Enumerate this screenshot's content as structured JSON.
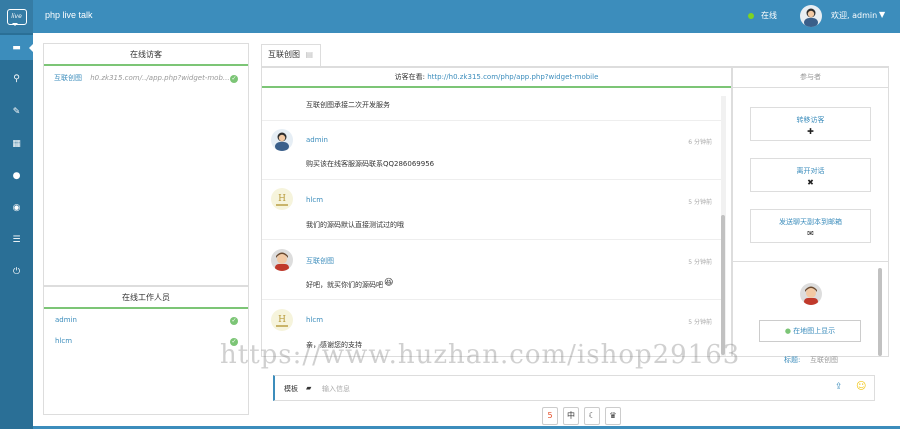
{
  "header": {
    "logo_text": "live",
    "app_title": "php live talk",
    "status": "在线",
    "welcome": "欢迎, admin"
  },
  "visitors_panel": {
    "title": "在线访客",
    "visitors": [
      {
        "name": "互联创图",
        "url": "h0.zk315.com/../app.php?widget-mob..."
      }
    ]
  },
  "staff_panel": {
    "title": "在线工作人员",
    "staff": [
      "admin",
      "hlcm"
    ]
  },
  "tabs": [
    {
      "label": "互联创图"
    }
  ],
  "chat": {
    "header_prefix": "访客在看:",
    "header_url": "http://h0.zk315.com/php/app.php?widget-mobile",
    "messages": [
      {
        "name": "",
        "time": "",
        "text": "互联创图承接二次开发服务"
      },
      {
        "name": "admin",
        "time": "6 分钟前",
        "text": "购买该在线客服源码联系QQ286069956"
      },
      {
        "name": "hlcm",
        "time": "5 分钟前",
        "text": "我们的源码默认直接测试过的哦"
      },
      {
        "name": "互联创图",
        "time": "5 分钟前",
        "text": "好吧，就买你们的源码吧"
      },
      {
        "name": "hlcm",
        "time": "5 分钟前",
        "text": "亲，感谢您的支持"
      }
    ]
  },
  "side_panel": {
    "title": "参与者",
    "buttons": [
      {
        "label": "转移访客",
        "icon": "plus-icon"
      },
      {
        "label": "离开对话",
        "icon": "close-icon"
      },
      {
        "label": "发送聊天副本到邮箱",
        "icon": "envelope-icon"
      }
    ],
    "map_button": "在地图上显示",
    "detail_label": "标题:",
    "detail_value": "互联创图"
  },
  "input": {
    "template_label": "模板",
    "placeholder": "输入信息"
  },
  "watermark": "https://www.huzhan.com/ishop29163",
  "colors": {
    "primary": "#3c8dbc",
    "nav_dark": "#2a6f96",
    "green": "#7cc576"
  }
}
